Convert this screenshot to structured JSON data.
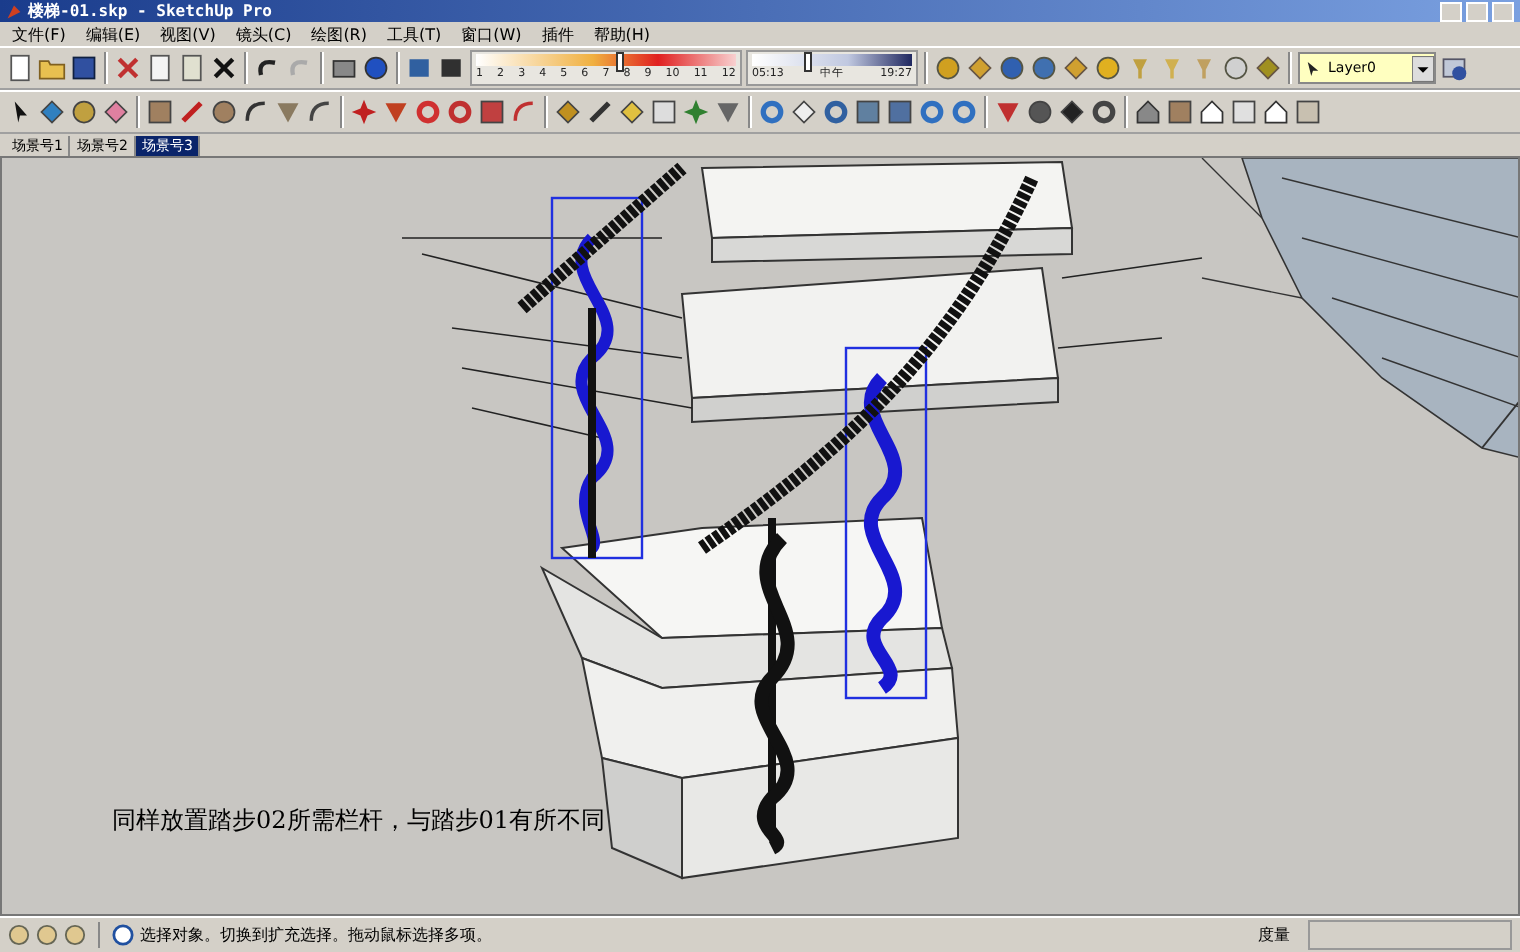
{
  "window": {
    "title": "楼梯-01.skp - SketchUp Pro"
  },
  "menu": [
    "文件(F)",
    "编辑(E)",
    "视图(V)",
    "镜头(C)",
    "绘图(R)",
    "工具(T)",
    "窗口(W)",
    "插件",
    "帮助(H)"
  ],
  "shadow": {
    "month_slider": {
      "level": 0.55
    },
    "time_slider": {
      "level": 0.35
    },
    "months": [
      "1",
      "2",
      "3",
      "4",
      "5",
      "6",
      "7",
      "8",
      "9",
      "10",
      "11",
      "12"
    ],
    "start_time": "05:13",
    "noon": "中午",
    "end_time": "19:27"
  },
  "layer": {
    "value": "Layer0"
  },
  "scene_tabs": [
    {
      "label": "场景号1",
      "selected": false
    },
    {
      "label": "场景号2",
      "selected": false
    },
    {
      "label": "场景号3",
      "selected": true
    }
  ],
  "viewport": {
    "caption": "同样放置踏步02所需栏杆，与踏步01有所不同"
  },
  "status_bar": {
    "message": "选择对象。切换到扩充选择。拖动鼠标选择多项。",
    "measure_label": "度量"
  }
}
